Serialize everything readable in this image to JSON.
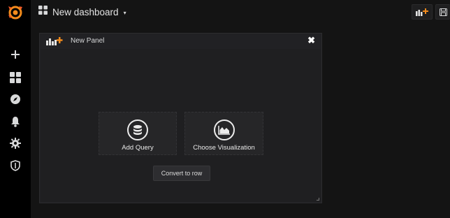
{
  "sidemenu": {
    "logo_icon": "grafana-logo-icon",
    "items": [
      {
        "name": "create",
        "icon": "plus-icon"
      },
      {
        "name": "dashboards",
        "icon": "grid-icon"
      },
      {
        "name": "explore",
        "icon": "compass-icon"
      },
      {
        "name": "alerting",
        "icon": "bell-icon"
      },
      {
        "name": "configuration",
        "icon": "gear-icon"
      },
      {
        "name": "server-admin",
        "icon": "shield-icon"
      }
    ]
  },
  "topbar": {
    "dashboard_title": "New dashboard",
    "caret": "▾",
    "buttons": [
      {
        "name": "add-panel",
        "icon": "add-panel-icon"
      },
      {
        "name": "save-dashboard",
        "icon": "save-icon"
      }
    ]
  },
  "panel": {
    "title": "New Panel",
    "close_glyph": "✖",
    "add_query_label": "Add Query",
    "choose_visualization_label": "Choose Visualization",
    "convert_to_row_label": "Convert to row"
  },
  "colors": {
    "brand_orange": "#f28b1c",
    "background": "#141414",
    "sidemenu": "#000000",
    "panel": "#212124"
  }
}
